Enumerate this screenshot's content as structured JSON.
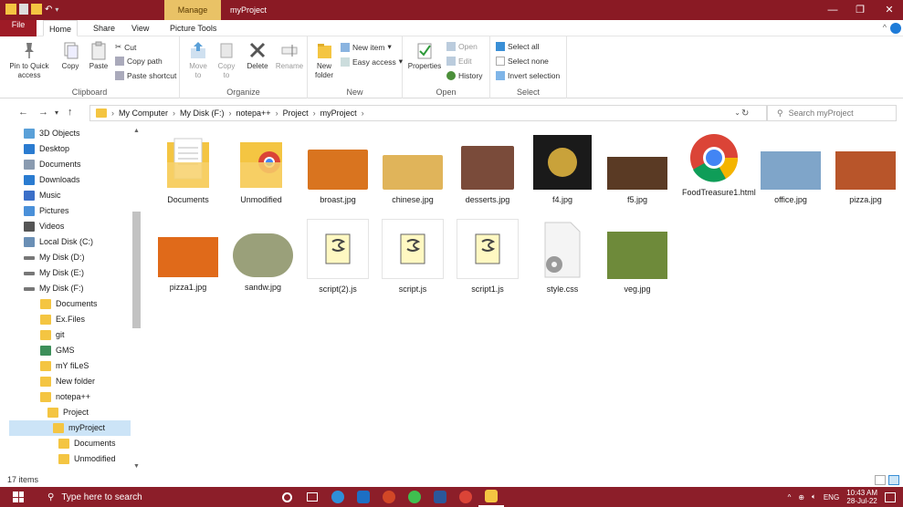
{
  "titlebar": {
    "contextual_tab": "Manage",
    "title": "myProject",
    "minimize": "—",
    "maximize": "❐",
    "close": "✕"
  },
  "tabs": {
    "file": "File",
    "home": "Home",
    "share": "Share",
    "view": "View",
    "picture_tools": "Picture Tools"
  },
  "ribbon": {
    "clipboard": {
      "name": "Clipboard",
      "pin": "Pin to Quick access",
      "copy": "Copy",
      "paste": "Paste",
      "cut": "Cut",
      "copy_path": "Copy path",
      "paste_shortcut": "Paste shortcut"
    },
    "organize": {
      "name": "Organize",
      "move_to": "Move to",
      "copy_to": "Copy to",
      "delete": "Delete",
      "rename": "Rename"
    },
    "new": {
      "name": "New",
      "new_folder": "New folder",
      "new_item": "New item",
      "easy_access": "Easy access"
    },
    "open": {
      "name": "Open",
      "properties": "Properties",
      "open": "Open",
      "edit": "Edit",
      "history": "History"
    },
    "select": {
      "name": "Select",
      "select_all": "Select all",
      "select_none": "Select none",
      "invert": "Invert selection"
    }
  },
  "address": {
    "crumbs": [
      "My Computer",
      "My Disk (F:)",
      "notepa++",
      "Project",
      "myProject"
    ],
    "search_placeholder": "Search myProject"
  },
  "nav": {
    "items": [
      {
        "label": "3D Objects",
        "color": "#5aa0d8"
      },
      {
        "label": "Desktop",
        "color": "#2a7bd0"
      },
      {
        "label": "Documents",
        "color": "#8a9bb0"
      },
      {
        "label": "Downloads",
        "color": "#2a7bd0"
      },
      {
        "label": "Music",
        "color": "#3b6fc8"
      },
      {
        "label": "Pictures",
        "color": "#4a90d9"
      },
      {
        "label": "Videos",
        "color": "#555555"
      },
      {
        "label": "Local Disk (C:)",
        "color": "#6a8fb5"
      },
      {
        "label": "My Disk  (D:)",
        "color": "#777777"
      },
      {
        "label": "My Disk (E:)",
        "color": "#777777"
      },
      {
        "label": "My Disk (F:)",
        "color": "#777777"
      },
      {
        "label": "Documents",
        "color": "#f4c542"
      },
      {
        "label": "Ex.Files",
        "color": "#f4c542"
      },
      {
        "label": "git",
        "color": "#f4c542"
      },
      {
        "label": "GMS",
        "color": "#3d8f5a"
      },
      {
        "label": "mY fiLeS",
        "color": "#f4c542"
      },
      {
        "label": "New folder",
        "color": "#f4c542"
      },
      {
        "label": "notepa++",
        "color": "#f4c542"
      },
      {
        "label": "Project",
        "color": "#f4c542"
      },
      {
        "label": "myProject",
        "color": "#f4c542"
      },
      {
        "label": "Documents",
        "color": "#f4c542"
      },
      {
        "label": "Unmodified",
        "color": "#f4c542"
      }
    ]
  },
  "files": [
    {
      "name": "Documents",
      "kind": "folder-docs"
    },
    {
      "name": "Unmodified",
      "kind": "folder-chrome"
    },
    {
      "name": "broast.jpg",
      "kind": "image",
      "color": "#d9741f"
    },
    {
      "name": "chinese.jpg",
      "kind": "image",
      "color": "#e0b45a"
    },
    {
      "name": "desserts.jpg",
      "kind": "image",
      "color": "#7a4b3a"
    },
    {
      "name": "f4.jpg",
      "kind": "image-dark",
      "color": "#1a1a1a"
    },
    {
      "name": "f5.jpg",
      "kind": "image",
      "color": "#5a3a24"
    },
    {
      "name": "FoodTreasure1.html",
      "kind": "chrome"
    },
    {
      "name": "office.jpg",
      "kind": "image",
      "color": "#7fa5c9"
    },
    {
      "name": "pizza.jpg",
      "kind": "image",
      "color": "#b8552a"
    },
    {
      "name": "pizza1.jpg",
      "kind": "image",
      "color": "#e06a1a"
    },
    {
      "name": "sandw.jpg",
      "kind": "image",
      "color": "#9aa07a"
    },
    {
      "name": "script(2).js",
      "kind": "js"
    },
    {
      "name": "script.js",
      "kind": "js"
    },
    {
      "name": "script1.js",
      "kind": "js"
    },
    {
      "name": "style.css",
      "kind": "css"
    },
    {
      "name": "veg.jpg",
      "kind": "image",
      "color": "#6e8a3a"
    }
  ],
  "status": {
    "count": "17 items"
  },
  "taskbar": {
    "search": "Type here to search",
    "lang": "ENG",
    "time": "10:43 AM",
    "date": "28-Jul-22"
  }
}
